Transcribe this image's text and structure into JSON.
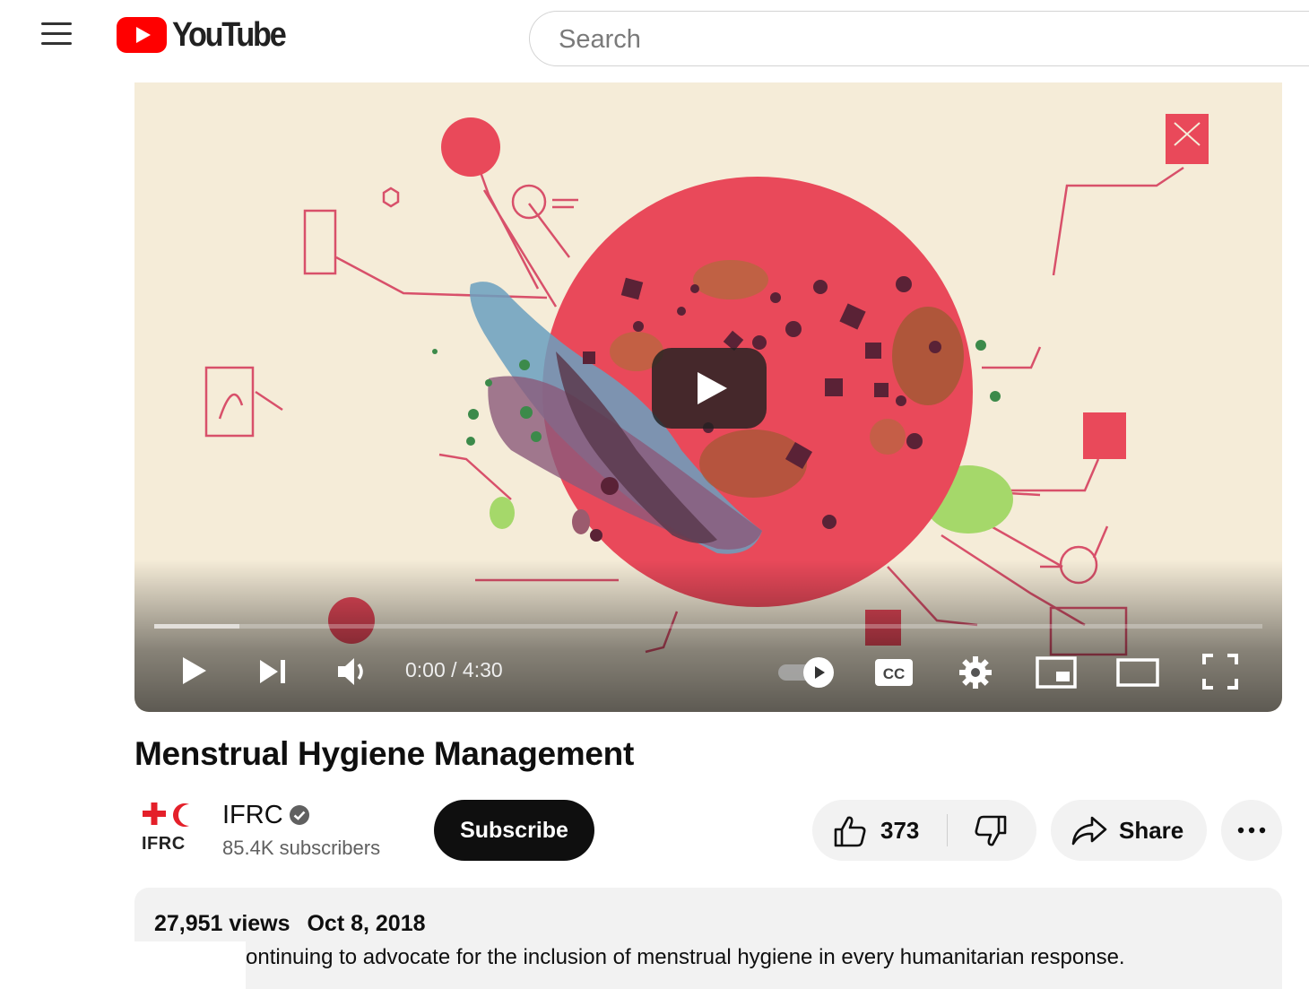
{
  "header": {
    "menu_icon": "hamburger-menu-icon",
    "logo_text": "YouTube",
    "search_placeholder": "Search"
  },
  "player": {
    "time_display": "0:00 / 4:30",
    "progress_loaded_fraction": 0.077,
    "icons": [
      "play-icon",
      "next-icon",
      "volume-icon",
      "autoplay-toggle-icon",
      "captions-icon",
      "settings-icon",
      "miniplayer-icon",
      "theater-mode-icon",
      "fullscreen-icon"
    ],
    "cc_label": "CC"
  },
  "video": {
    "title": "Menstrual Hygiene Management"
  },
  "channel": {
    "name": "IFRC",
    "logo_abbr": "IFRC",
    "subscribers": "85.4K subscribers",
    "subscribe_label": "Subscribe"
  },
  "actions": {
    "like_count": "373",
    "share_label": "Share",
    "more_label": "···"
  },
  "description": {
    "views": "27,951 views",
    "date": "Oct 8, 2018",
    "line1": "ontinuing to advocate for the inclusion of menstrual hygiene in every humanitarian response.",
    "line2": ""
  },
  "colors": {
    "youtube_red": "#ff0000",
    "ifrc_red": "#e4202a",
    "art_background": "#f5ecd8",
    "art_circle": "#e9495a"
  }
}
